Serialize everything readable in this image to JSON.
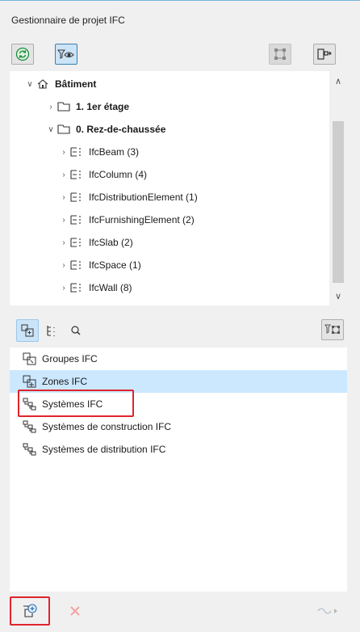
{
  "window": {
    "title": "Gestionnaire de projet IFC"
  },
  "toolbar": {
    "refresh_icon": "refresh-icon",
    "filter_icon": "filter-eye-icon",
    "select_icon": "select-element-icon",
    "layout_icon": "layout-toggle-icon"
  },
  "tree": {
    "building": "Bâtiment",
    "floor1": "1. 1er étage",
    "floor0": "0. Rez-de-chaussée",
    "items": [
      "IfcBeam (3)",
      "IfcColumn (4)",
      "IfcDistributionElement (1)",
      "IfcFurnishingElement (2)",
      "IfcSlab (2)",
      "IfcSpace (1)",
      "IfcWall (8)"
    ]
  },
  "groups": {
    "items": [
      "Groupes IFC",
      "Zones IFC",
      "Systèmes IFC",
      "Systèmes de construction IFC",
      "Systèmes de distribution IFC"
    ],
    "selected_index": 1
  },
  "colors": {
    "selection": "#cce8ff",
    "highlight": "#e0242b",
    "accent": "#1a8f3c"
  }
}
